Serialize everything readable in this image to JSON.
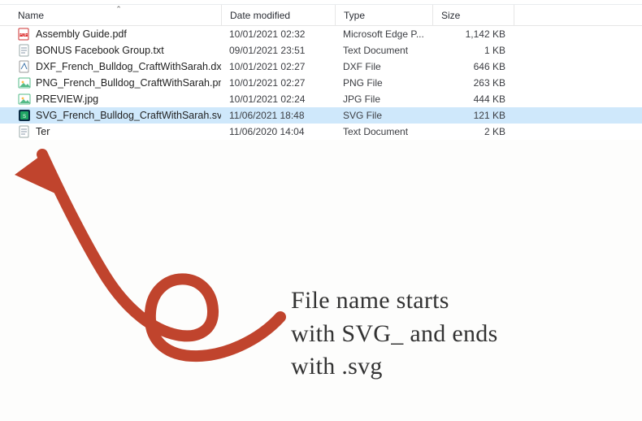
{
  "colors": {
    "accent_arrow": "#c0442d",
    "selection": "#cfe8fb"
  },
  "columns": {
    "name": "Name",
    "date": "Date modified",
    "type": "Type",
    "size": "Size"
  },
  "files": [
    {
      "icon": "pdf",
      "name": "Assembly Guide.pdf",
      "date": "10/01/2021 02:32",
      "type": "Microsoft Edge P...",
      "size": "1,142 KB",
      "selected": false
    },
    {
      "icon": "txt",
      "name": "BONUS Facebook Group.txt",
      "date": "09/01/2021 23:51",
      "type": "Text Document",
      "size": "1 KB",
      "selected": false
    },
    {
      "icon": "dxf",
      "name": "DXF_French_Bulldog_CraftWithSarah.dxf",
      "date": "10/01/2021 02:27",
      "type": "DXF File",
      "size": "646 KB",
      "selected": false
    },
    {
      "icon": "png",
      "name": "PNG_French_Bulldog_CraftWithSarah.png",
      "date": "10/01/2021 02:27",
      "type": "PNG File",
      "size": "263 KB",
      "selected": false
    },
    {
      "icon": "jpg",
      "name": "PREVIEW.jpg",
      "date": "10/01/2021 02:24",
      "type": "JPG File",
      "size": "444 KB",
      "selected": false
    },
    {
      "icon": "svg",
      "name": "SVG_French_Bulldog_CraftWithSarah.svg",
      "date": "11/06/2021 18:48",
      "type": "SVG File",
      "size": "121 KB",
      "selected": true
    },
    {
      "icon": "txt",
      "name": "Ter",
      "date": "11/06/2020 14:04",
      "type": "Text Document",
      "size": "2 KB",
      "selected": false,
      "truncated": true
    }
  ],
  "annotation": {
    "line1": "File name starts",
    "line2": "with SVG_ and ends",
    "line3": "with .svg"
  }
}
